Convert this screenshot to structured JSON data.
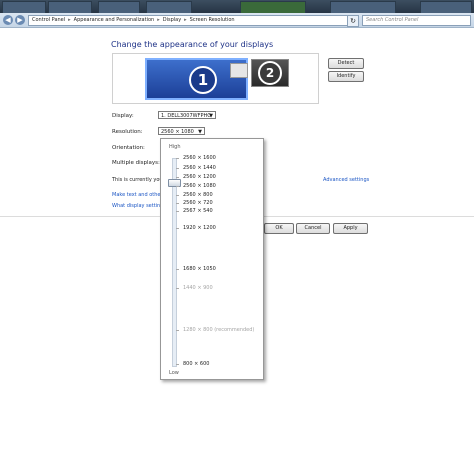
{
  "addressbar": {
    "breadcrumbs": [
      "Control Panel",
      "Appearance and Personalization",
      "Display",
      "Screen Resolution"
    ],
    "search_placeholder": "Search Control Panel"
  },
  "heading": "Change the appearance of your displays",
  "monitors": [
    {
      "number": "1",
      "selected": true
    },
    {
      "number": "2",
      "selected": false
    }
  ],
  "buttons": {
    "detect": "Detect",
    "identify": "Identify",
    "ok": "OK",
    "cancel": "Cancel",
    "apply": "Apply"
  },
  "fields": {
    "display_label": "Display:",
    "display_value": "1. DELL3007WFPHC",
    "resolution_label": "Resolution:",
    "resolution_value": "2560 × 1080",
    "orientation_label": "Orientation:",
    "multiple_displays_label": "Multiple displays:",
    "this_currently": "This is currently you"
  },
  "links": {
    "advanced": "Advanced settings",
    "make_text": "Make text and other",
    "what_display": "What display settings"
  },
  "resolution_dropdown": {
    "high_label": "High",
    "low_label": "Low",
    "slider_level": 0.1,
    "options": [
      {
        "text": "2560 × 1600",
        "faded": false
      },
      {
        "text": "2560 × 1440",
        "faded": false
      },
      {
        "text": "2560 × 1200",
        "faded": false
      },
      {
        "text": "2560 × 1080",
        "faded": false
      },
      {
        "text": "2560 × 800",
        "faded": false
      },
      {
        "text": "2560 × 720",
        "faded": false
      },
      {
        "text": "2567 × 540",
        "faded": false
      },
      {
        "text": "1920 × 1200",
        "faded": false
      },
      {
        "text": "1680 × 1050",
        "faded": false
      },
      {
        "text": "1440 × 900",
        "faded": true
      },
      {
        "text": "1280 × 800 (recommended)",
        "faded": true
      },
      {
        "text": "800 × 600",
        "faded": false
      }
    ]
  }
}
